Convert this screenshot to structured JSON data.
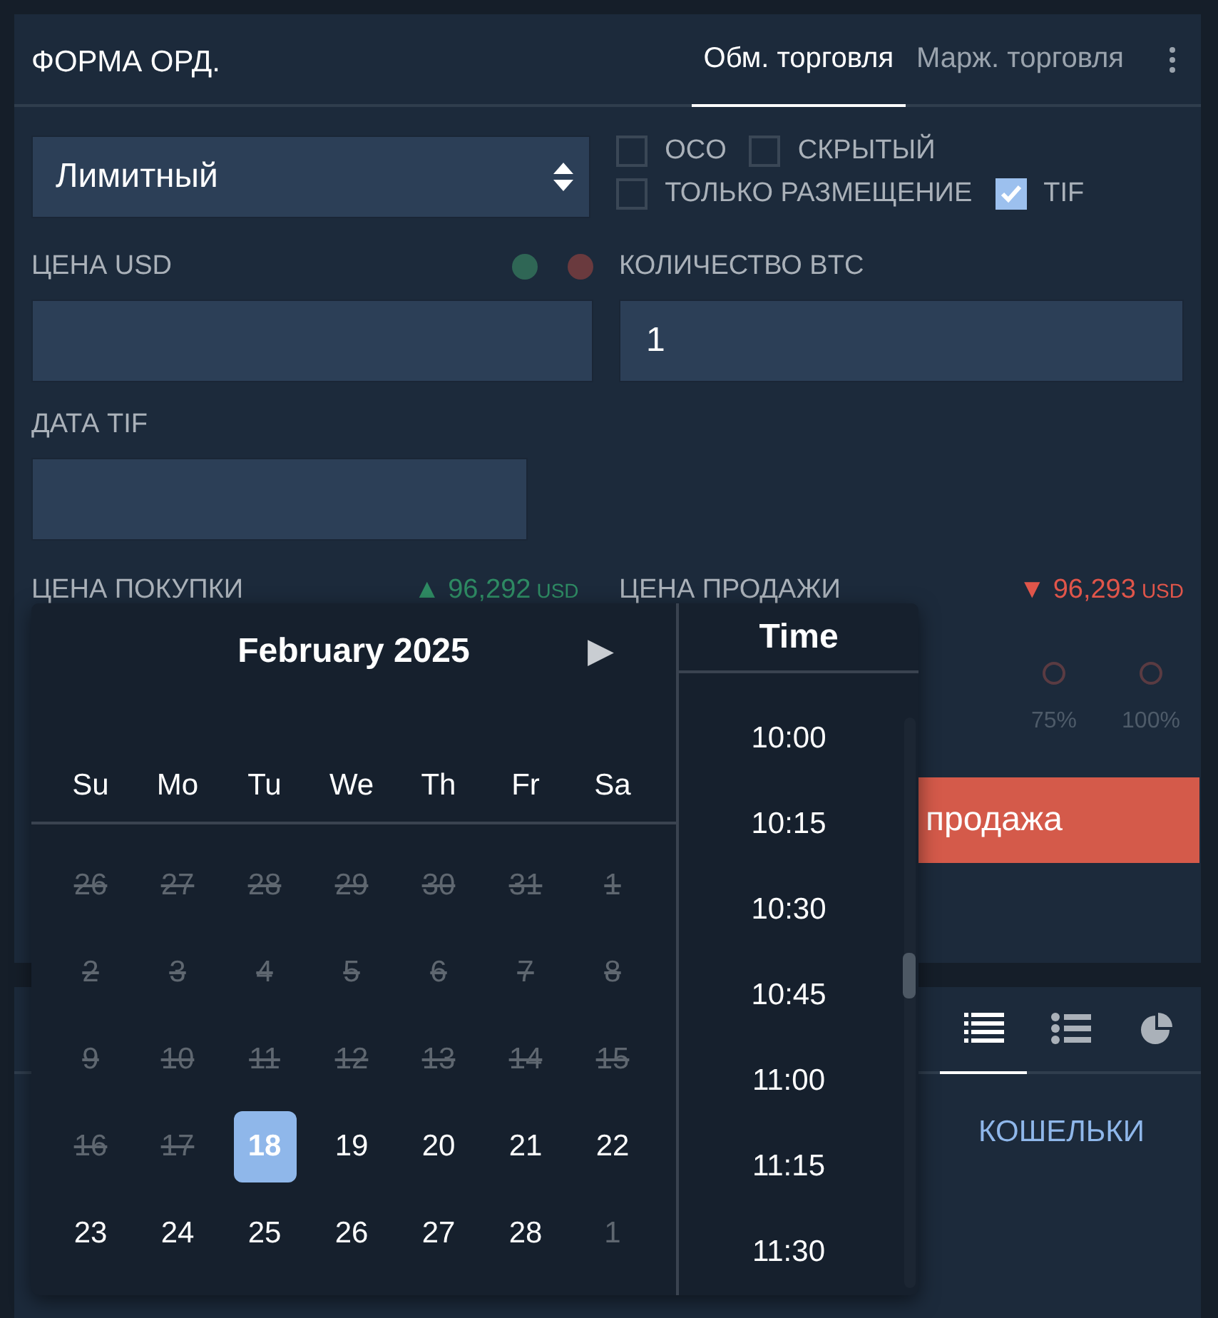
{
  "order_form": {
    "title": "ФОРМА ОРД.",
    "tabs": [
      {
        "label": "Обм. торговля",
        "selected": true
      },
      {
        "label": "Марж. торговля",
        "selected": false
      }
    ],
    "order_type": {
      "value": "Лимитный"
    },
    "options": [
      {
        "label": "OCO",
        "checked": false
      },
      {
        "label": "СКРЫТЫЙ",
        "checked": false
      },
      {
        "label": "ТОЛЬКО РАЗМЕЩЕНИЕ",
        "checked": false
      },
      {
        "label": "TIF",
        "checked": true
      }
    ],
    "price": {
      "label": "ЦЕНА USD"
    },
    "quantity": {
      "label": "КОЛИЧЕСТВО BTC",
      "value": "1"
    },
    "tif_date": {
      "label": "ДАТА TIF"
    },
    "buy_price": {
      "label": "ЦЕНА ПОКУПКИ",
      "arrow": "▲",
      "value": "96,292",
      "currency": "USD"
    },
    "sell_price": {
      "label": "ЦЕНА ПРОДАЖИ",
      "arrow": "▼",
      "value": "96,293",
      "currency": "USD"
    },
    "percent_options": [
      {
        "label": "75%",
        "selected": false
      },
      {
        "label": "100%",
        "selected": false
      }
    ],
    "sell_button": "продажа"
  },
  "lower_panel": {
    "views": [
      {
        "kind": "list",
        "selected": true
      },
      {
        "kind": "bullets",
        "selected": false
      },
      {
        "kind": "pie",
        "selected": false
      }
    ],
    "link": "КОШЕЛЬКИ"
  },
  "date_picker": {
    "month": "February 2025",
    "next": "▶",
    "weekdays": [
      "Su",
      "Mo",
      "Tu",
      "We",
      "Th",
      "Fr",
      "Sa"
    ],
    "days": [
      {
        "label": "26",
        "kind": "past",
        "selected": false
      },
      {
        "label": "27",
        "kind": "past",
        "selected": false
      },
      {
        "label": "28",
        "kind": "past",
        "selected": false
      },
      {
        "label": "29",
        "kind": "past",
        "selected": false
      },
      {
        "label": "30",
        "kind": "past",
        "selected": false
      },
      {
        "label": "31",
        "kind": "past",
        "selected": false
      },
      {
        "label": "1",
        "kind": "past",
        "selected": false
      },
      {
        "label": "2",
        "kind": "past",
        "selected": false
      },
      {
        "label": "3",
        "kind": "past",
        "selected": false
      },
      {
        "label": "4",
        "kind": "past",
        "selected": false
      },
      {
        "label": "5",
        "kind": "past",
        "selected": false
      },
      {
        "label": "6",
        "kind": "past",
        "selected": false
      },
      {
        "label": "7",
        "kind": "past",
        "selected": false
      },
      {
        "label": "8",
        "kind": "past",
        "selected": false
      },
      {
        "label": "9",
        "kind": "past",
        "selected": false
      },
      {
        "label": "10",
        "kind": "past",
        "selected": false
      },
      {
        "label": "11",
        "kind": "past",
        "selected": false
      },
      {
        "label": "12",
        "kind": "past",
        "selected": false
      },
      {
        "label": "13",
        "kind": "past",
        "selected": false
      },
      {
        "label": "14",
        "kind": "past",
        "selected": false
      },
      {
        "label": "15",
        "kind": "past",
        "selected": false
      },
      {
        "label": "16",
        "kind": "past",
        "selected": false
      },
      {
        "label": "17",
        "kind": "past",
        "selected": false
      },
      {
        "label": "18",
        "kind": "day",
        "selected": true
      },
      {
        "label": "19",
        "kind": "day",
        "selected": false
      },
      {
        "label": "20",
        "kind": "day",
        "selected": false
      },
      {
        "label": "21",
        "kind": "day",
        "selected": false
      },
      {
        "label": "22",
        "kind": "day",
        "selected": false
      },
      {
        "label": "23",
        "kind": "day",
        "selected": false
      },
      {
        "label": "24",
        "kind": "day",
        "selected": false
      },
      {
        "label": "25",
        "kind": "day",
        "selected": false
      },
      {
        "label": "26",
        "kind": "day",
        "selected": false
      },
      {
        "label": "27",
        "kind": "day",
        "selected": false
      },
      {
        "label": "28",
        "kind": "day",
        "selected": false
      },
      {
        "label": "1",
        "kind": "next-month",
        "selected": false
      }
    ],
    "time_title": "Time",
    "times": [
      "10:00",
      "10:15",
      "10:30",
      "10:45",
      "11:00",
      "11:15",
      "11:30"
    ]
  }
}
